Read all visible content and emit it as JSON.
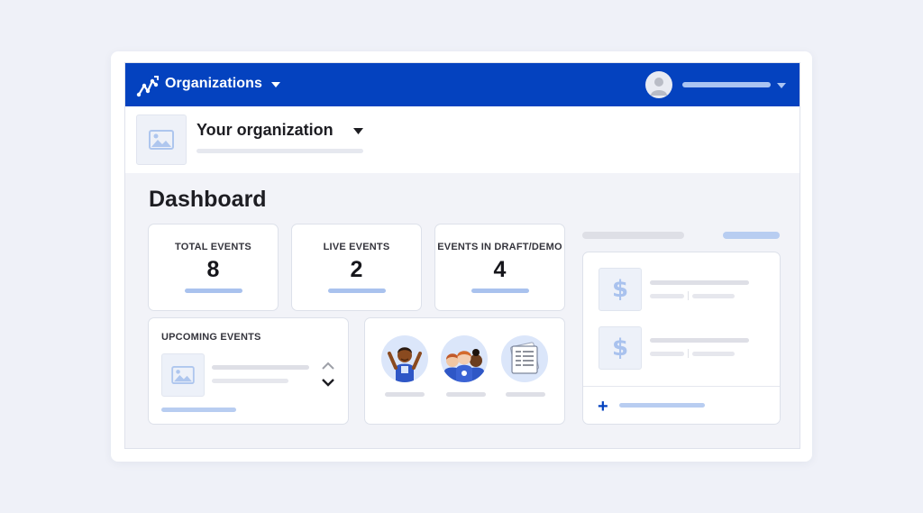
{
  "header": {
    "brand": "Organizations",
    "icons": [
      "analytics-logo-icon",
      "chevron-down-icon",
      "user-avatar-icon"
    ],
    "color": "#0442bf"
  },
  "org": {
    "name": "Your organization"
  },
  "dashboard": {
    "title": "Dashboard",
    "stats": [
      {
        "label": "TOTAL EVENTS",
        "value": "8"
      },
      {
        "label": "LIVE EVENTS",
        "value": "2"
      },
      {
        "label": "EVENTS IN DRAFT/DEMO",
        "value": "4"
      }
    ],
    "upcoming": {
      "label": "UPCOMING EVENTS"
    },
    "money_icon": "$",
    "add_icon": "+"
  }
}
